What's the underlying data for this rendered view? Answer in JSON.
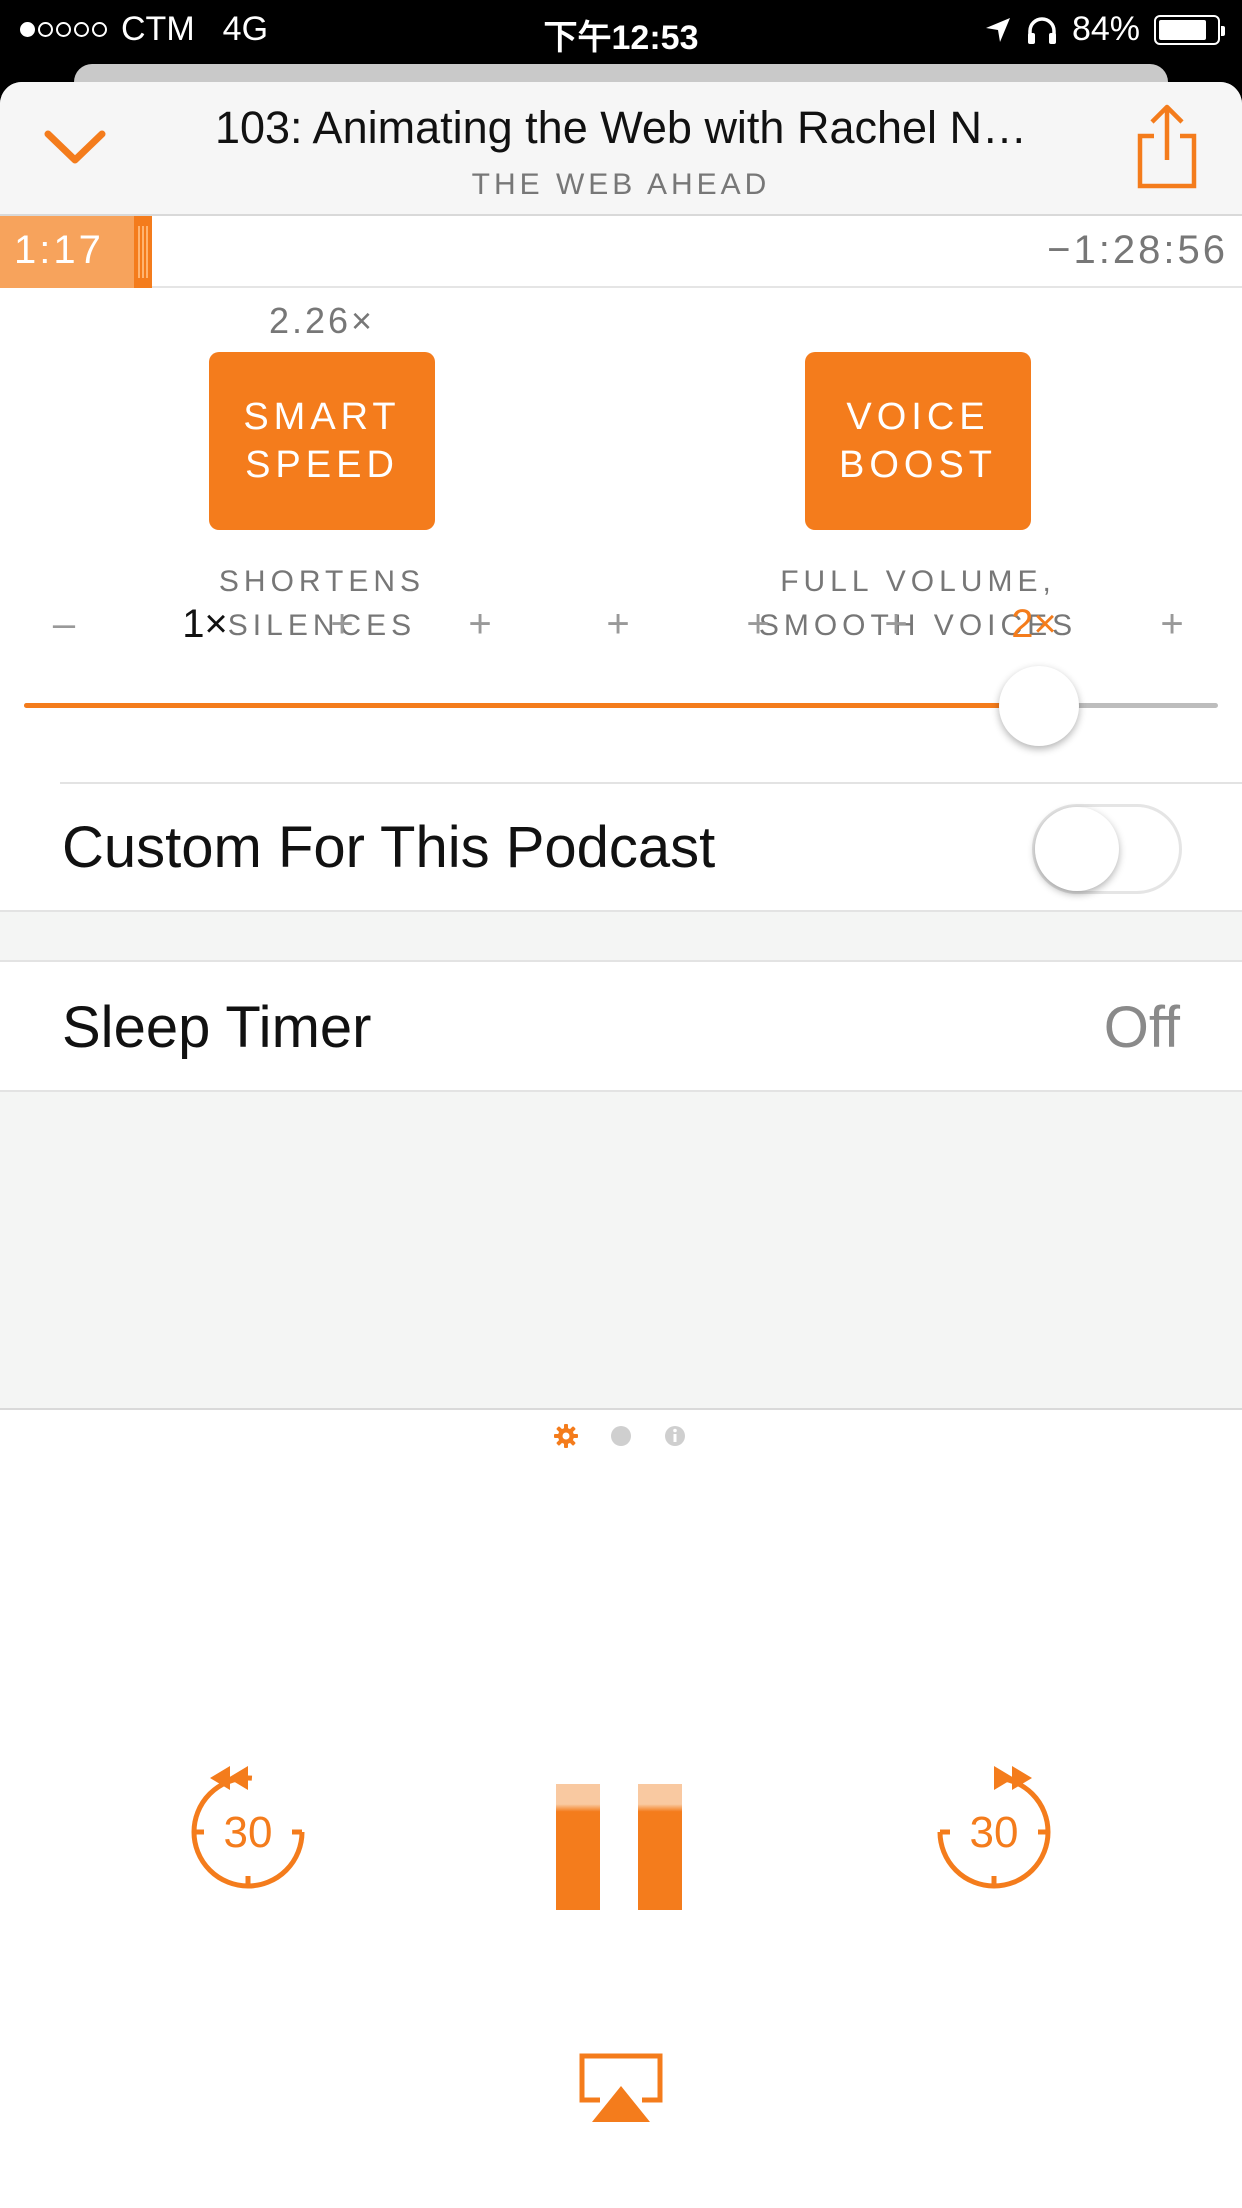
{
  "status_bar": {
    "carrier": "CTM",
    "network": "4G",
    "time": "下午12:53",
    "battery": "84%",
    "signal_bars": 1,
    "battery_level": 0.84
  },
  "header": {
    "episode_title": "103: Animating the Web with Rachel N…",
    "show_title": "THE WEB AHEAD"
  },
  "progress": {
    "elapsed": "1:17",
    "remaining": "−1:28:56"
  },
  "effects": {
    "smart_speed": {
      "value": "2.26×",
      "line1": "SMART",
      "line2": "SPEED",
      "desc1": "SHORTENS",
      "desc2": "SILENCES"
    },
    "voice_boost": {
      "line1": "VOICE",
      "line2": "BOOST",
      "desc1": "FULL VOLUME,",
      "desc2": "SMOOTH VOICES"
    }
  },
  "speed": {
    "ticks": [
      "–",
      "1×",
      "+",
      "+",
      "+",
      "+",
      "+",
      "2×",
      "+"
    ],
    "level": 0.85
  },
  "settings": {
    "custom_label": "Custom For This Podcast",
    "custom_enabled": false,
    "sleep_label": "Sleep Timer",
    "sleep_value": "Off"
  },
  "player": {
    "skip_back": "30",
    "skip_forward": "30"
  },
  "colors": {
    "accent": "#f47c1c",
    "accent_light": "#f7a35c",
    "text_gray": "#777777"
  },
  "icons": {
    "collapse": "chevron-down-icon",
    "share": "share-icon",
    "pager_settings": "gear-icon",
    "pager_info": "info-icon",
    "airplay": "airplay-icon"
  }
}
